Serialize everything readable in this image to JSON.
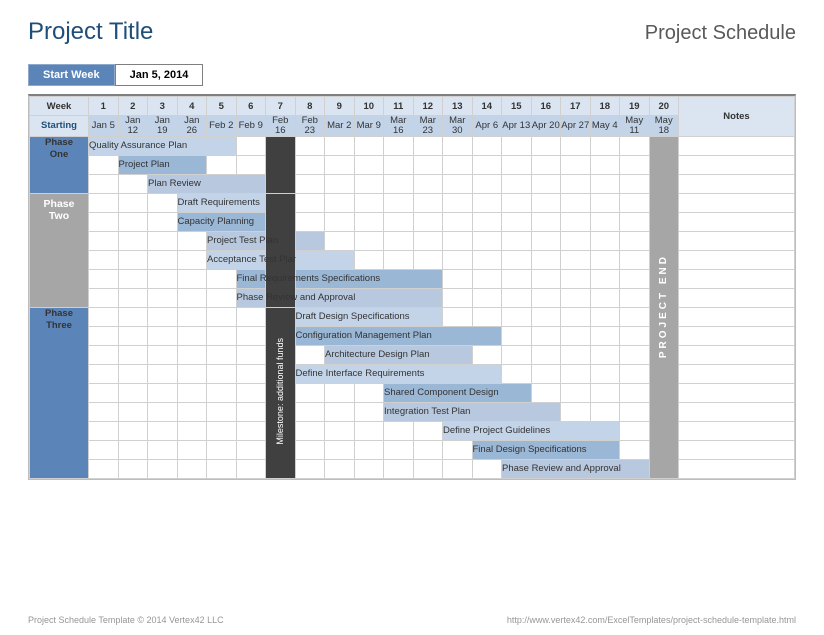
{
  "title": "Project Title",
  "heading": "Project Schedule",
  "start_week": {
    "label": "Start Week",
    "value": "Jan 5, 2014"
  },
  "header": {
    "week_label": "Week",
    "starting_label": "Starting",
    "notes_label": "Notes",
    "weeks": [
      "1",
      "2",
      "3",
      "4",
      "5",
      "6",
      "7",
      "8",
      "9",
      "10",
      "11",
      "12",
      "13",
      "14",
      "15",
      "16",
      "17",
      "18",
      "19",
      "20"
    ],
    "dates": [
      "Jan 5",
      "Jan 12",
      "Jan 19",
      "Jan 26",
      "Feb 2",
      "Feb 9",
      "Feb 16",
      "Feb 23",
      "Mar 2",
      "Mar 9",
      "Mar 16",
      "Mar 23",
      "Mar 30",
      "Apr 6",
      "Apr 13",
      "Apr 20",
      "Apr 27",
      "May 4",
      "May 11",
      "May 18"
    ]
  },
  "phases": {
    "one": {
      "label_a": "Phase",
      "label_b": "One"
    },
    "two": {
      "label_a": "Phase",
      "label_b": "Two"
    },
    "three": {
      "label_a": "Phase",
      "label_b": "Three"
    }
  },
  "tasks": {
    "t1": "Quality Assurance Plan",
    "t2": "Project Plan",
    "t3": "Plan Review",
    "t4": "Draft Requirements",
    "t5": "Capacity Planning",
    "t6": "Project Test Plan",
    "t7": "Acceptance Test Plan",
    "t8": "Final Requirements Specifications",
    "t9": "Phase Review and Approval",
    "t10": "Draft Design Specifications",
    "t11": "Configuration Management Plan",
    "t12": "Architecture Design Plan",
    "t13": "Define Interface Requirements",
    "t14": "Shared Component Design",
    "t15": "Integration Test Plan",
    "t16": "Define Project Guidelines",
    "t17": "Final Design Specifications",
    "t18": "Phase Review and Approval"
  },
  "milestone": "Milestone: additional funds",
  "project_end": "PROJECT END",
  "chart_data": {
    "type": "bar",
    "title": "Project Schedule",
    "xlabel": "Week",
    "x": [
      1,
      2,
      3,
      4,
      5,
      6,
      7,
      8,
      9,
      10,
      11,
      12,
      13,
      14,
      15,
      16,
      17,
      18,
      19,
      20
    ],
    "x_dates": [
      "Jan 5",
      "Jan 12",
      "Jan 19",
      "Jan 26",
      "Feb 2",
      "Feb 9",
      "Feb 16",
      "Feb 23",
      "Mar 2",
      "Mar 9",
      "Mar 16",
      "Mar 23",
      "Mar 30",
      "Apr 6",
      "Apr 13",
      "Apr 20",
      "Apr 27",
      "May 4",
      "May 11",
      "May 18"
    ],
    "series": [
      {
        "name": "Quality Assurance Plan",
        "phase": "One",
        "start": 1,
        "end": 5
      },
      {
        "name": "Project Plan",
        "phase": "One",
        "start": 2,
        "end": 4
      },
      {
        "name": "Plan Review",
        "phase": "One",
        "start": 3,
        "end": 6
      },
      {
        "name": "Draft Requirements",
        "phase": "Two",
        "start": 4,
        "end": 6
      },
      {
        "name": "Capacity Planning",
        "phase": "Two",
        "start": 4,
        "end": 6
      },
      {
        "name": "Project Test Plan",
        "phase": "Two",
        "start": 5,
        "end": 8
      },
      {
        "name": "Acceptance Test Plan",
        "phase": "Two",
        "start": 5,
        "end": 9
      },
      {
        "name": "Final Requirements Specifications",
        "phase": "Two",
        "start": 6,
        "end": 12
      },
      {
        "name": "Phase Review and Approval",
        "phase": "Two",
        "start": 6,
        "end": 12
      },
      {
        "name": "Draft Design Specifications",
        "phase": "Three",
        "start": 8,
        "end": 12
      },
      {
        "name": "Configuration Management Plan",
        "phase": "Three",
        "start": 8,
        "end": 14
      },
      {
        "name": "Architecture Design Plan",
        "phase": "Three",
        "start": 9,
        "end": 13
      },
      {
        "name": "Define Interface Requirements",
        "phase": "Three",
        "start": 8,
        "end": 14
      },
      {
        "name": "Shared Component Design",
        "phase": "Three",
        "start": 11,
        "end": 15
      },
      {
        "name": "Integration Test Plan",
        "phase": "Three",
        "start": 11,
        "end": 16
      },
      {
        "name": "Define Project Guidelines",
        "phase": "Three",
        "start": 13,
        "end": 18
      },
      {
        "name": "Final Design Specifications",
        "phase": "Three",
        "start": 14,
        "end": 18
      },
      {
        "name": "Phase Review and Approval",
        "phase": "Three",
        "start": 15,
        "end": 19
      }
    ],
    "milestones": [
      {
        "name": "Milestone: additional funds",
        "week": 7
      },
      {
        "name": "PROJECT END",
        "week": 20
      }
    ]
  },
  "footer": {
    "left": "Project Schedule Template © 2014 Vertex42 LLC",
    "right": "http://www.vertex42.com/ExcelTemplates/project-schedule-template.html"
  }
}
